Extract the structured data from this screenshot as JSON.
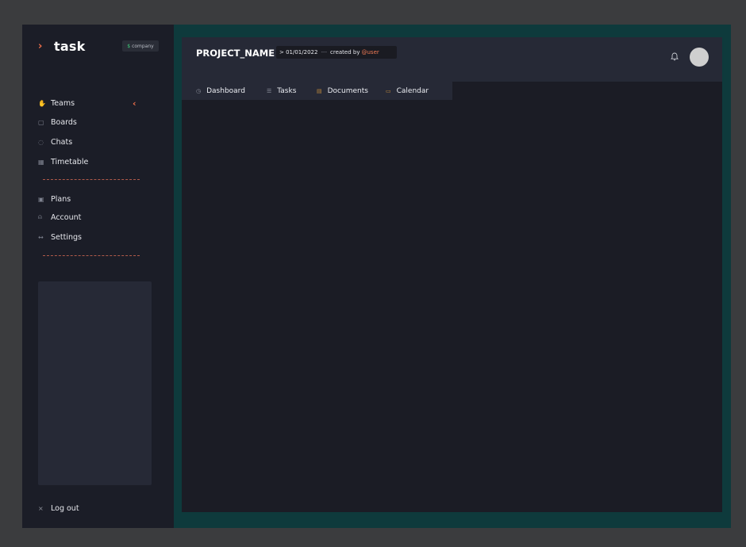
{
  "brand": {
    "name": "task",
    "chevron": "›"
  },
  "company": {
    "symbol": "$",
    "label": "company"
  },
  "sidebar": {
    "primary": [
      {
        "label": "Teams",
        "icon": "hand-icon",
        "glyph": "✋"
      },
      {
        "label": "Boards",
        "icon": "board-icon",
        "glyph": "▢"
      },
      {
        "label": "Chats",
        "icon": "chat-icon",
        "glyph": "◌"
      },
      {
        "label": "Timetable",
        "icon": "grid-icon",
        "glyph": "▦"
      }
    ],
    "secondary": [
      {
        "label": "Plans",
        "icon": "bag-icon",
        "glyph": "▣"
      },
      {
        "label": "Account",
        "icon": "user-icon",
        "glyph": "⍝"
      },
      {
        "label": "Settings",
        "icon": "settings-icon",
        "glyph": "↔"
      }
    ],
    "collapse_glyph": "‹",
    "logout": {
      "label": "Log out",
      "glyph": "×"
    }
  },
  "header": {
    "project_title": "PROJECT_NAME",
    "date": "> 01/01/2022",
    "separator": "---",
    "created_by": "created by",
    "user": "@user",
    "bell_glyph": "🔔"
  },
  "tabs": [
    {
      "label": "Dashboard",
      "icon": "clock-icon",
      "glyph": "◷"
    },
    {
      "label": "Tasks",
      "icon": "list-icon",
      "glyph": "☰"
    },
    {
      "label": "Documents",
      "icon": "document-icon",
      "glyph": "▤"
    },
    {
      "label": "Calendar",
      "icon": "calendar-icon",
      "glyph": "▭"
    }
  ],
  "colors": {
    "accent": "#f06f4a",
    "frame": "#0e3a3c",
    "sidebar": "#1b1d27",
    "panel": "#262936",
    "money": "#3ecf7a"
  }
}
